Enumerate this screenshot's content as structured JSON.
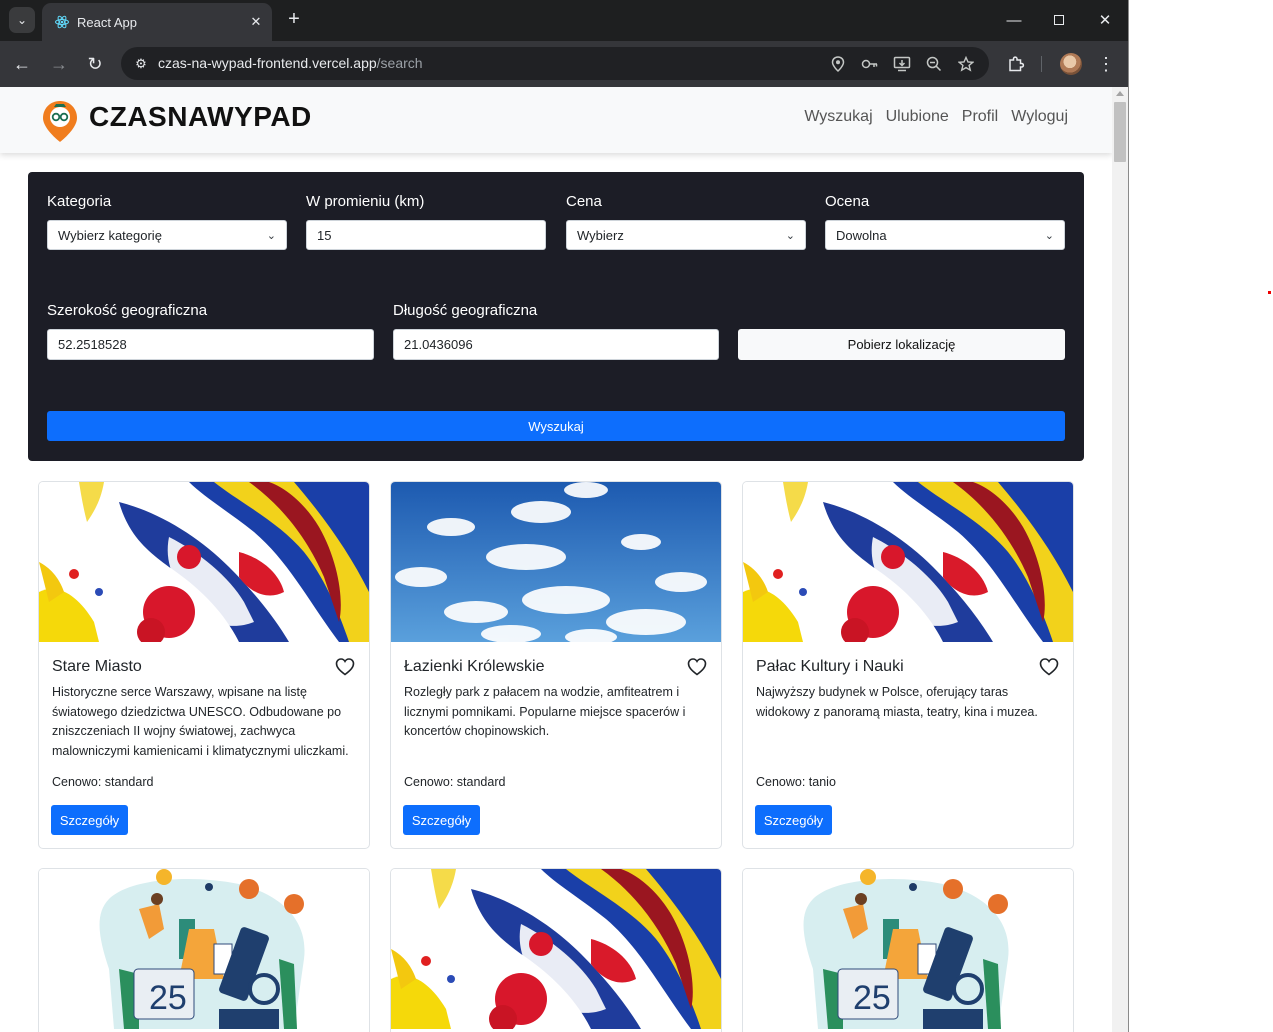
{
  "browser": {
    "tab_title": "React App",
    "url_host": "czas-na-wypad-frontend.vercel.app",
    "url_path": "/search"
  },
  "navbar": {
    "brand": "CZASNAWYPAD",
    "links": [
      "Wyszukaj",
      "Ulubione",
      "Profil",
      "Wyloguj"
    ]
  },
  "filters": {
    "category_label": "Kategoria",
    "category_value": "Wybierz kategorię",
    "radius_label": "W promieniu (km)",
    "radius_value": "15",
    "price_label": "Cena",
    "price_value": "Wybierz",
    "rating_label": "Ocena",
    "rating_value": "Dowolna",
    "lat_label": "Szerokość geograficzna",
    "lat_value": "52.2518528",
    "lng_label": "Długość geograficzna",
    "lng_value": "21.0436096",
    "locate_button": "Pobierz lokalizację",
    "search_button": "Wyszukaj"
  },
  "cards": [
    {
      "title": "Stare Miasto",
      "description": "Historyczne serce Warszawy, wpisane na listę światowego dziedzictwa UNESCO. Odbudowane po zniszczeniach II wojny światowej, zachwyca malowniczymi kamienicami i klimatycznymi uliczkami.",
      "price": "Cenowo: standard",
      "details": "Szczegóły",
      "image": "paint-splash"
    },
    {
      "title": "Łazienki Królewskie",
      "description": "Rozległy park z pałacem na wodzie, amfiteatrem i licznymi pomnikami. Popularne miejsce spacerów i koncertów chopinowskich.",
      "price": "Cenowo: standard",
      "details": "Szczegóły",
      "image": "sky-clouds"
    },
    {
      "title": "Pałac Kultury i Nauki",
      "description": "Najwyższy budynek w Polsce, oferujący taras widokowy z panoramą miasta, teatry, kina i muzea.",
      "price": "Cenowo: tanio",
      "details": "Szczegóły",
      "image": "paint-splash"
    },
    {
      "image": "science-illustration",
      "illustration_text": "25"
    },
    {
      "image": "paint-splash"
    },
    {
      "image": "science-illustration",
      "illustration_text": "25"
    }
  ]
}
